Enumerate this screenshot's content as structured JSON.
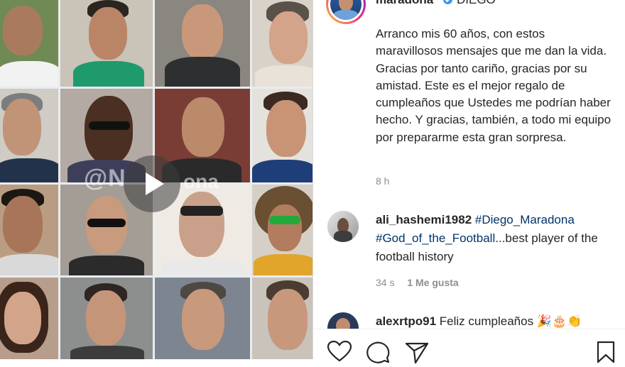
{
  "video": {
    "watermark_left": "@N",
    "watermark_right": "ona",
    "play_icon": "play-icon"
  },
  "post": {
    "username": "maradona",
    "username_extra": "DIEGO",
    "caption": "Arranco mis 60 años, con estos maravillosos mensajes que me dan la vida. Gracias por tanto cariño, gracias por su amistad. Este es el mejor regalo de cumpleaños que Ustedes me podrían haber hecho. Y gracias, también, a todo mi equipo por prepararme esta gran sorpresa.",
    "time": "8 h"
  },
  "comments": [
    {
      "user": "ali_hashemi1982",
      "tag1": "#Diego_Maradona",
      "tag2": "#God_of_the_Football",
      "text": "...best player of the football history",
      "time": "34 s",
      "likes": "1 Me gusta"
    },
    {
      "user": "alexrtpo91",
      "text": "Feliz cumpleaños",
      "emojis": "🎉🎂👏"
    }
  ],
  "actions": {
    "like": "heart-icon",
    "comment": "comment-icon",
    "share": "share-icon",
    "save": "bookmark-icon"
  },
  "colors": {
    "link": "#003569",
    "verified": "#3897f0",
    "meta": "#8e8e8e",
    "text": "#262626"
  }
}
